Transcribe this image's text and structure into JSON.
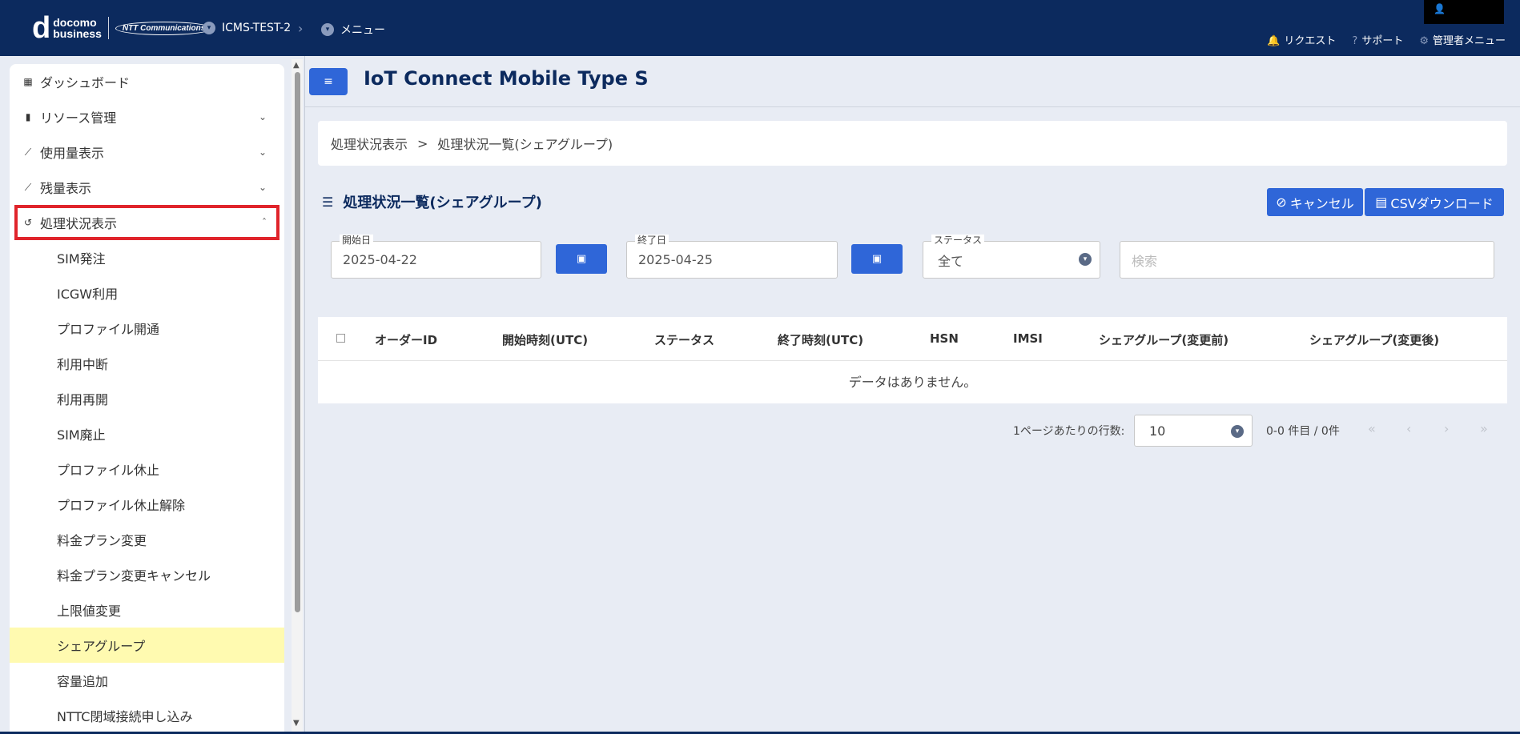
{
  "header": {
    "logo_d": "d",
    "logo_line1": "docomo",
    "logo_line2": "business",
    "logo_ntt": "NTT Communications",
    "breadcrumb": [
      "ICMS-TEST-2",
      "メニュー"
    ],
    "right_links": [
      {
        "icon": "bell-icon",
        "label": "リクエスト"
      },
      {
        "icon": "help-icon",
        "label": "サポート"
      },
      {
        "icon": "gear-icon",
        "label": "管理者メニュー"
      }
    ]
  },
  "sidebar": {
    "items": [
      {
        "icon": "dashboard-icon",
        "label": "ダッシュボード"
      },
      {
        "icon": "sim-icon",
        "label": "リソース管理"
      },
      {
        "icon": "chart-icon",
        "label": "使用量表示"
      },
      {
        "icon": "chart-icon",
        "label": "残量表示"
      },
      {
        "icon": "history-icon",
        "label": "処理状況表示"
      }
    ],
    "sub_items": [
      "SIM発注",
      "ICGW利用",
      "プロファイル開通",
      "利用中断",
      "利用再開",
      "SIM廃止",
      "プロファイル休止",
      "プロファイル休止解除",
      "料金プラン変更",
      "料金プラン変更キャンセル",
      "上限値変更",
      "シェアグループ",
      "容量追加",
      "NTTC閉域接続申し込み"
    ],
    "selected_sub": "シェアグループ"
  },
  "main": {
    "title": "IoT Connect Mobile Type S",
    "breadcrumb": {
      "parent": "処理状況表示",
      "sep": ">",
      "current": "処理状況一覧(シェアグループ)"
    },
    "section_title": "処理状況一覧(シェアグループ)",
    "cancel_label": "キャンセル",
    "csv_label": "CSVダウンロード",
    "filters": {
      "start_label": "開始日",
      "start_value": "2025-04-22",
      "end_label": "終了日",
      "end_value": "2025-04-25",
      "status_label": "ステータス",
      "status_value": "全て",
      "search_placeholder": "検索"
    },
    "table": {
      "columns": [
        "オーダーID",
        "開始時刻(UTC)",
        "ステータス",
        "終了時刻(UTC)",
        "HSN",
        "IMSI",
        "シェアグループ(変更前)",
        "シェアグループ(変更後)"
      ],
      "empty": "データはありません。"
    },
    "pager": {
      "rows_label": "1ページあたりの行数:",
      "rows_value": "10",
      "count": "0-0 件目 / 0件",
      "nav": [
        "«",
        "‹",
        "›",
        "»"
      ]
    }
  }
}
